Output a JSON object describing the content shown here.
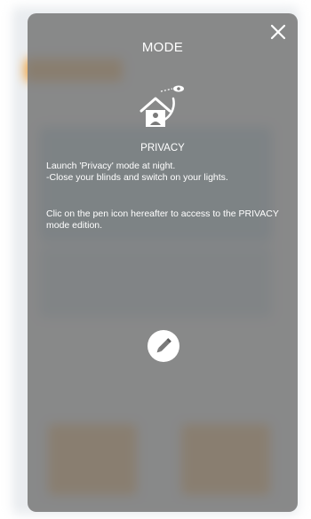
{
  "modal": {
    "title": "MODE",
    "close_icon": "close-icon",
    "mode_icon": "house-privacy-icon",
    "mode_name": "PRIVACY",
    "description_line1": "Launch 'Privacy' mode at night.",
    "description_line2": "-Close your blinds and switch on your lights.",
    "hint_text": "Clic on the pen icon hereafter to access to the PRIVACY mode edition.",
    "edit_icon": "pen-icon"
  },
  "colors": {
    "overlay": "#7a7a7a",
    "text": "#ffffff",
    "background_accent": "#f2a23a"
  }
}
